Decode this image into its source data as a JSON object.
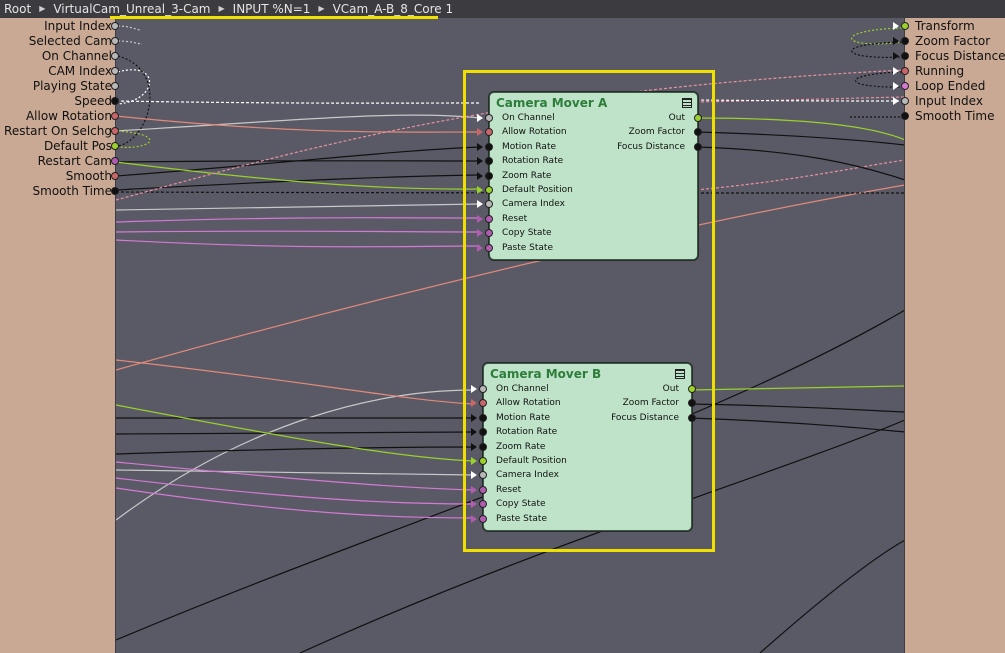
{
  "breadcrumb": {
    "items": [
      "Root",
      "VirtualCam_Unreal_3-Cam",
      "INPUT %N=1",
      "VCam_A-B_8_Core 1"
    ]
  },
  "left_ports": [
    {
      "label": "Input Index",
      "color": "#b8b8b8"
    },
    {
      "label": "Selected Cam",
      "color": "#b8b8b8"
    },
    {
      "label": "On Channel",
      "color": "#b8b8b8"
    },
    {
      "label": "CAM Index",
      "color": "#b8b8b8"
    },
    {
      "label": "Playing State",
      "color": "#b8b8b8"
    },
    {
      "label": "Speed",
      "color": "#111111"
    },
    {
      "label": "Allow Rotation",
      "color": "#c8666a"
    },
    {
      "label": "Restart On Selchg",
      "color": "#c8666a"
    },
    {
      "label": "Default Pos",
      "color": "#9ad12a"
    },
    {
      "label": "Restart Cam",
      "color": "#b05cb0"
    },
    {
      "label": "Smooth",
      "color": "#c8666a"
    },
    {
      "label": "Smooth Time",
      "color": "#111111"
    }
  ],
  "right_ports": [
    {
      "label": "Transform",
      "color": "#9ad12a"
    },
    {
      "label": "Zoom Factor",
      "color": "#111111"
    },
    {
      "label": "Focus Distance",
      "color": "#111111"
    },
    {
      "label": "Running",
      "color": "#c8666a"
    },
    {
      "label": "Loop Ended",
      "color": "#d47ad4"
    },
    {
      "label": "Input Index",
      "color": "#b8b8b8"
    },
    {
      "label": "Smooth Time",
      "color": "#111111"
    }
  ],
  "nodes": [
    {
      "title": "Camera Mover A",
      "inputs": [
        {
          "label": "On Channel",
          "color": "#b8b8b8"
        },
        {
          "label": "Allow Rotation",
          "color": "#c8666a"
        },
        {
          "label": "Motion Rate",
          "color": "#111111"
        },
        {
          "label": "Rotation Rate",
          "color": "#111111"
        },
        {
          "label": "Zoom Rate",
          "color": "#111111"
        },
        {
          "label": "Default Position",
          "color": "#9ad12a"
        },
        {
          "label": "Camera Index",
          "color": "#b8b8b8"
        },
        {
          "label": "Reset",
          "color": "#b05cb0"
        },
        {
          "label": "Copy State",
          "color": "#b05cb0"
        },
        {
          "label": "Paste State",
          "color": "#b05cb0"
        }
      ],
      "outputs": [
        {
          "label": "Out",
          "color": "#9ad12a"
        },
        {
          "label": "Zoom Factor",
          "color": "#111111"
        },
        {
          "label": "Focus Distance",
          "color": "#111111"
        }
      ]
    },
    {
      "title": "Camera Mover B",
      "inputs": [
        {
          "label": "On Channel",
          "color": "#b8b8b8"
        },
        {
          "label": "Allow Rotation",
          "color": "#c8666a"
        },
        {
          "label": "Motion Rate",
          "color": "#111111"
        },
        {
          "label": "Rotation Rate",
          "color": "#111111"
        },
        {
          "label": "Zoom Rate",
          "color": "#111111"
        },
        {
          "label": "Default Position",
          "color": "#9ad12a"
        },
        {
          "label": "Camera Index",
          "color": "#b8b8b8"
        },
        {
          "label": "Reset",
          "color": "#b05cb0"
        },
        {
          "label": "Copy State",
          "color": "#b05cb0"
        },
        {
          "label": "Paste State",
          "color": "#b05cb0"
        }
      ],
      "outputs": [
        {
          "label": "Out",
          "color": "#9ad12a"
        },
        {
          "label": "Zoom Factor",
          "color": "#111111"
        },
        {
          "label": "Focus Distance",
          "color": "#111111"
        }
      ]
    }
  ],
  "colors": {
    "canvas": "#5a5a66",
    "node_body": "#bfe3c9",
    "node_title": "#2e7d3a",
    "selection": "#f0e000",
    "panel": "#c9a994"
  }
}
